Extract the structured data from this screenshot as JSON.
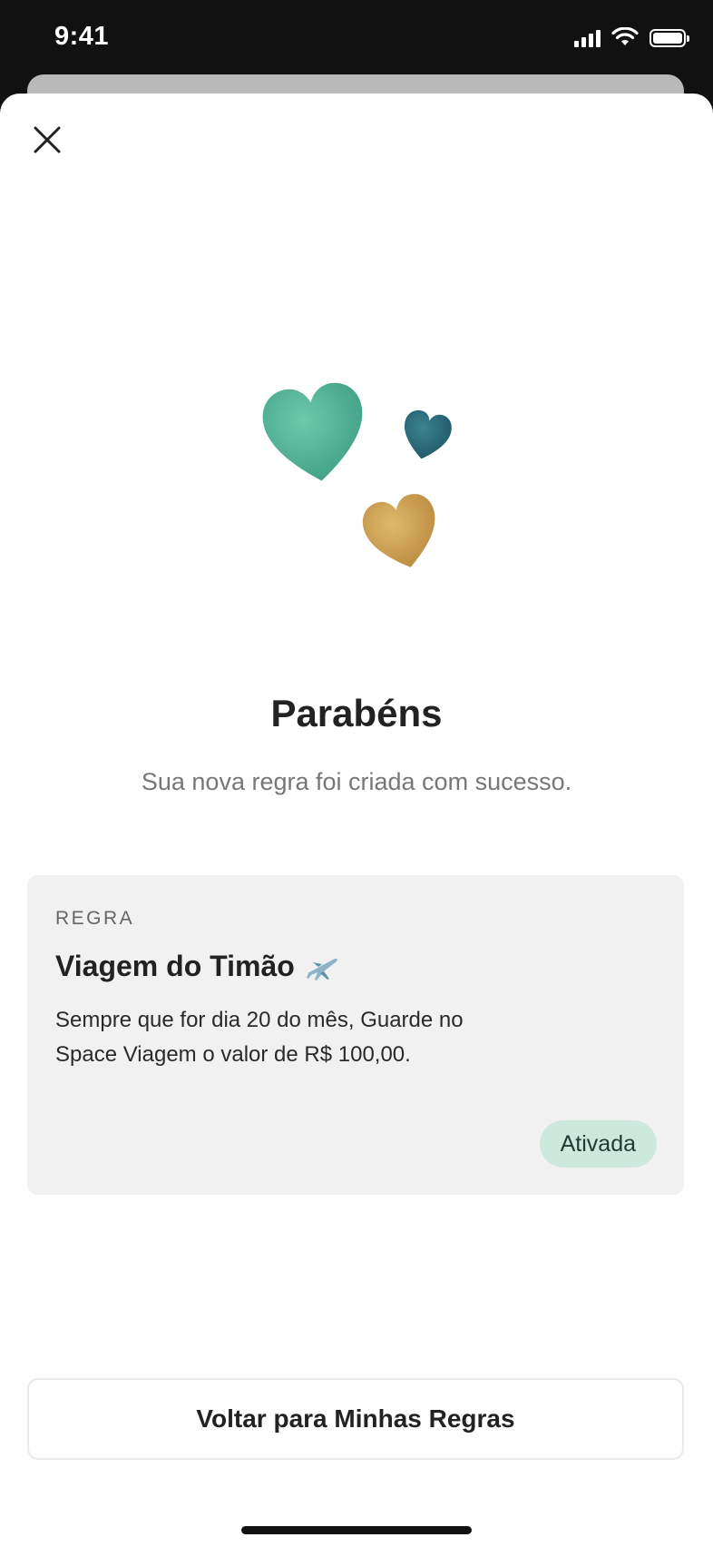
{
  "status_bar": {
    "time": "9:41"
  },
  "header": {
    "close_icon": "close-icon"
  },
  "illustration": {
    "hearts": [
      {
        "name": "heart-teal-icon",
        "color": "#5cb89b"
      },
      {
        "name": "heart-dark-teal-icon",
        "color": "#2e6b7a"
      },
      {
        "name": "heart-gold-icon",
        "color": "#d1a659"
      }
    ]
  },
  "main": {
    "title": "Parabéns",
    "subtitle": "Sua nova regra foi criada com sucesso."
  },
  "rule_card": {
    "overline": "REGRA",
    "title": "Viagem do Timão",
    "icon": "airplane-icon",
    "description": "Sempre que for dia 20 do mês, Guarde no Space Viagem o valor de R$ 100,00.",
    "status": "Ativada",
    "status_color": "#cde9de"
  },
  "footer": {
    "back_button_label": "Voltar para Minhas Regras"
  }
}
